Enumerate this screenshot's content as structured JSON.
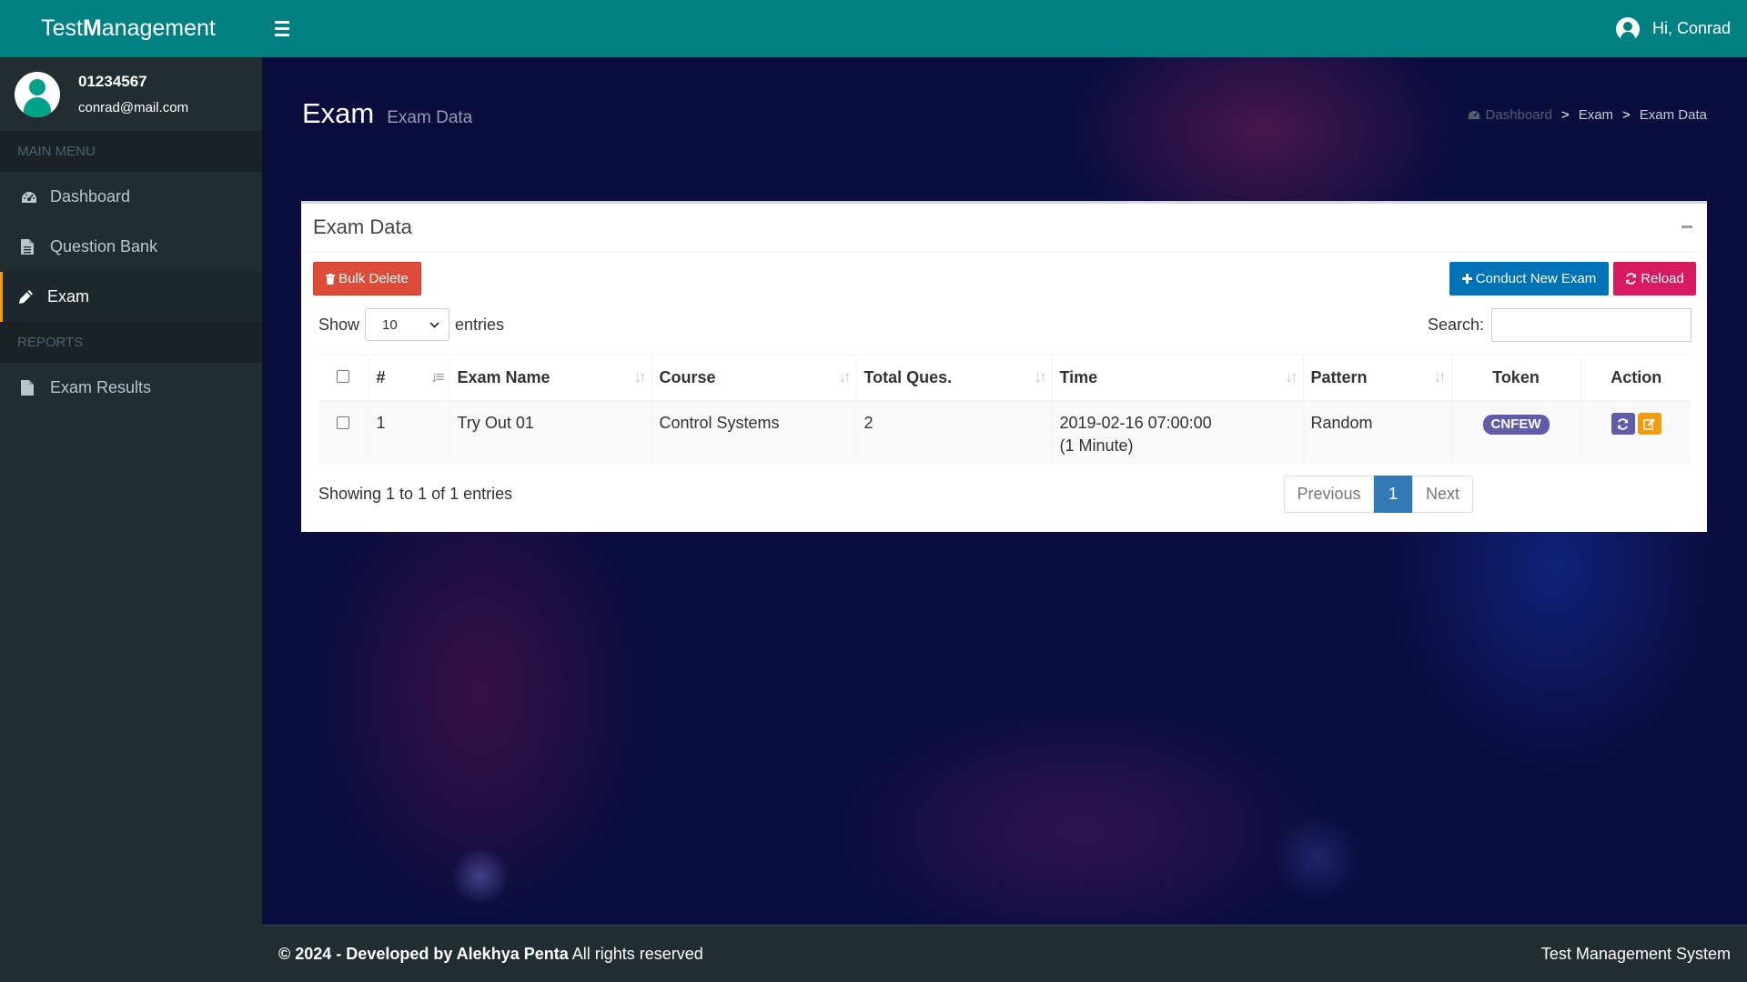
{
  "header": {
    "brand_part1": "Test ",
    "brand_bold": "M",
    "brand_part2": "anagement",
    "greeting": "Hi, Conrad"
  },
  "sidebar": {
    "user_id": "01234567",
    "user_email": "conrad@mail.com",
    "main_menu_label": "MAIN MENU",
    "reports_label": "REPORTS",
    "items": [
      {
        "label": "Dashboard",
        "icon": "dashboard-icon"
      },
      {
        "label": "Question Bank",
        "icon": "file-text-icon"
      },
      {
        "label": "Exam",
        "icon": "pencil-icon",
        "active": true
      },
      {
        "label": "Exam Results",
        "icon": "file-icon"
      }
    ]
  },
  "page": {
    "title": "Exam",
    "subtitle": "Exam Data",
    "breadcrumb": [
      "Dashboard",
      "Exam",
      "Exam Data"
    ],
    "breadcrumb_sep": ">"
  },
  "box": {
    "title": "Exam Data",
    "bulk_delete": "Bulk Delete",
    "conduct_new": "Conduct New Exam",
    "reload": "Reload",
    "show_label": "Show",
    "entries_label": "entries",
    "page_size": "10",
    "search_label": "Search:",
    "search_value": "",
    "columns": [
      "#",
      "Exam Name",
      "Course",
      "Total Ques.",
      "Time",
      "Pattern",
      "Token",
      "Action"
    ],
    "rows": [
      {
        "no": "1",
        "exam_name": "Try Out 01",
        "course": "Control Systems",
        "total_ques": "2",
        "time_line1": "2019-02-16 07:00:00",
        "time_line2": "(1 Minute)",
        "pattern": "Random",
        "token": "CNFEW"
      }
    ],
    "info": "Showing 1 to 1 of 1 entries",
    "pager": {
      "previous": "Previous",
      "current": "1",
      "next": "Next"
    }
  },
  "footer": {
    "copyright": "© 2024 - Developed by Alekhya Penta",
    "rights": " All rights reserved",
    "system_name": "Test Management System"
  },
  "colors": {
    "header_bg": "#008080",
    "sidebar_bg": "#222d32",
    "active_border": "#f39c12",
    "danger": "#dd4b39",
    "primary": "#0073b7",
    "pink": "#d81b60",
    "token_badge": "#605ca8",
    "pager_active": "#337ab7"
  }
}
